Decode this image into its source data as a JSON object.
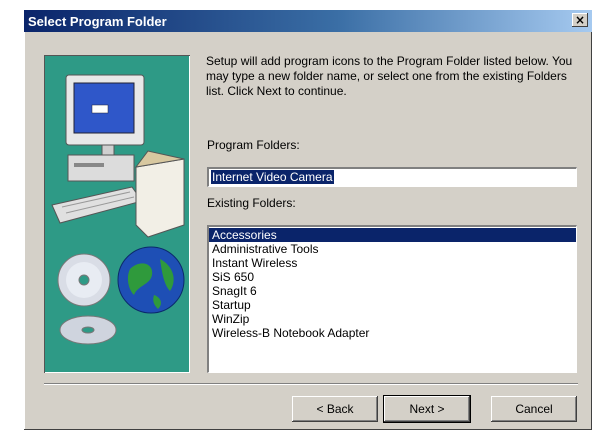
{
  "dialog": {
    "title": "Select Program Folder",
    "close_glyph": "×",
    "instructions": "Setup will add program icons to the Program Folder listed below. You may type a new folder name, or select one from the existing Folders list.  Click Next to continue.",
    "program_folders_label": "Program Folders:",
    "program_folder_value": "Internet Video Camera",
    "existing_folders_label": "Existing Folders:",
    "existing_folders": [
      "Accessories",
      "Administrative Tools",
      "Instant Wireless",
      "SiS 650",
      "SnagIt  6",
      "Startup",
      "WinZip",
      "Wireless-B Notebook Adapter"
    ],
    "selected_folder": "Accessories",
    "buttons": {
      "back": "< Back",
      "next": "Next >",
      "cancel": "Cancel"
    }
  },
  "colors": {
    "panel_teal": "#2e9a86",
    "title_blue": "#0a246a",
    "selection": "#0a246a",
    "dialog_face": "#d4d0c8"
  },
  "icons": [
    "computer-illustration",
    "cd-disc-icon",
    "globe-icon"
  ]
}
